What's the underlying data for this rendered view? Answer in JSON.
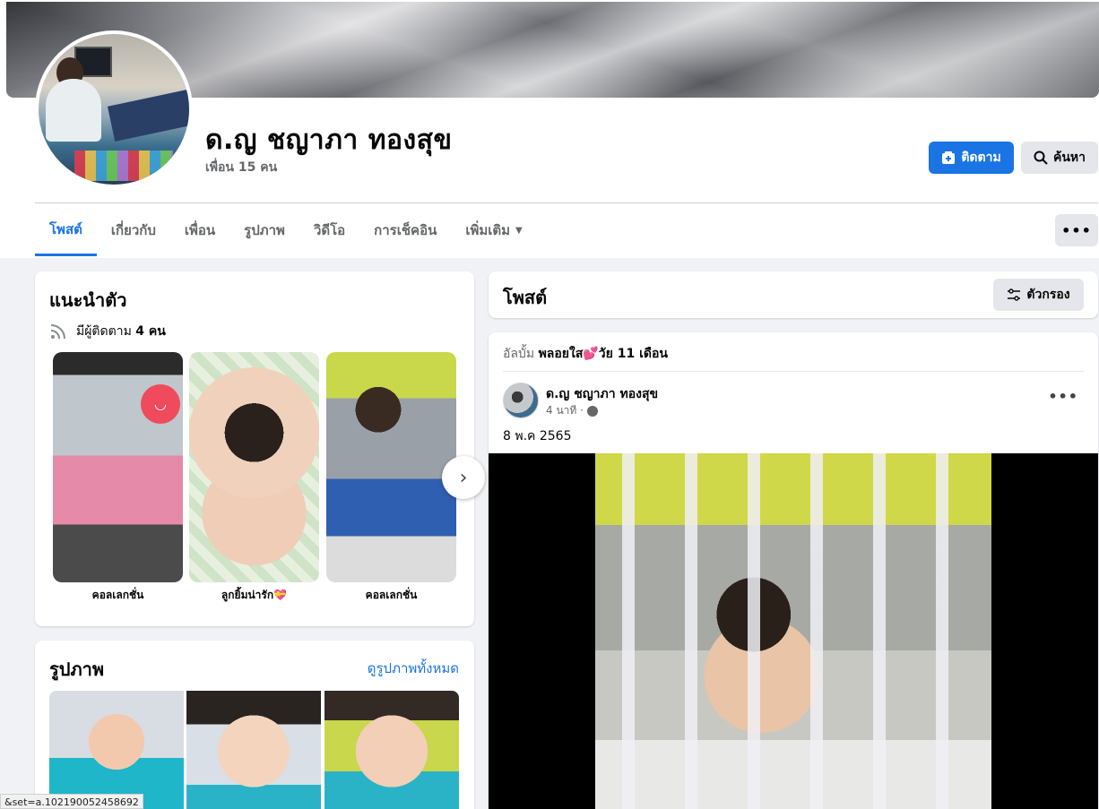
{
  "profile": {
    "name": "ด.ญ ชญาภา ทองสุข",
    "friends": "เพื่อน 15 คน"
  },
  "actions": {
    "follow_label": "ติดตาม",
    "search_label": "ค้นหา",
    "more_label": "•••"
  },
  "tabs": [
    {
      "label": "โพสต์"
    },
    {
      "label": "เกี่ยวกับ"
    },
    {
      "label": "เพื่อน"
    },
    {
      "label": "รูปภาพ"
    },
    {
      "label": "วิดีโอ"
    },
    {
      "label": "การเช็คอิน"
    },
    {
      "label": "เพิ่มเติม"
    }
  ],
  "intro": {
    "title": "แนะนำตัว",
    "followers_prefix": "มีผู้ติดตาม",
    "followers_count": "4 คน",
    "highlights": [
      {
        "caption": "คอลเลกชั่น"
      },
      {
        "caption": "ลูกยิ้มน่ารัก💝"
      },
      {
        "caption": "คอลเลกชั่น"
      }
    ]
  },
  "photos": {
    "title": "รูปภาพ",
    "see_all": "ดูรูปภาพทั้งหมด"
  },
  "posts": {
    "title": "โพสต์",
    "filter_label": "ตัวกรอง"
  },
  "post": {
    "album_prefix": "อัลบั้ม",
    "album_name": "พลอยใส💕วัย 11 เดือน",
    "author": "ด.ญ ชญาภา ทองสุข",
    "time": "4 นาที ·",
    "text": "8 พ.ค 2565",
    "menu": "•••"
  },
  "status_bar": {
    "url": "&set=a.102190052458692"
  },
  "colors": {
    "accent": "#1b74e4",
    "background": "#f0f2f5",
    "button_gray": "#e4e6eb",
    "secondary_text": "#65676b"
  }
}
